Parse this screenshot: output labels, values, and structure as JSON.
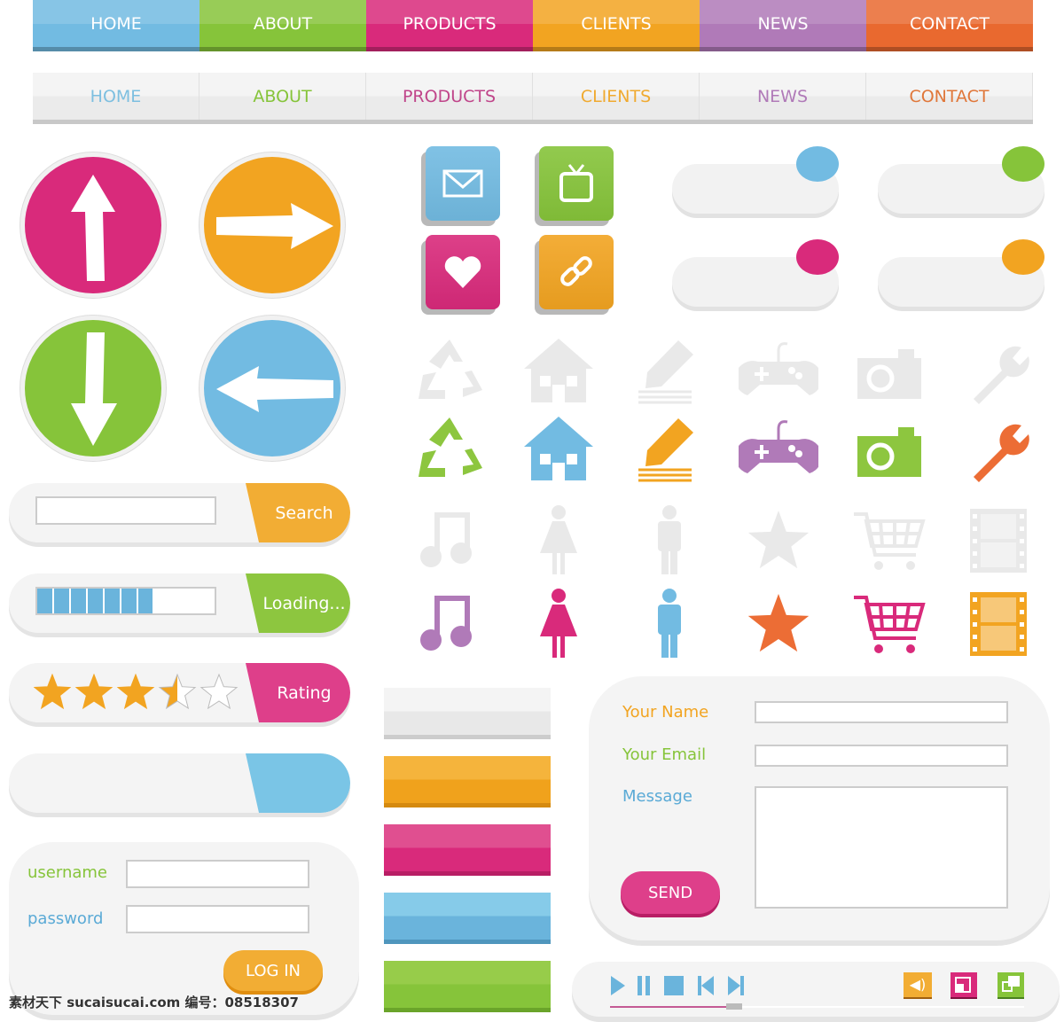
{
  "colors": {
    "blue": "#7ac5e6",
    "green": "#8dc63f",
    "pink": "#d8287a",
    "orange": "#f3a524",
    "purple": "#b57fc0",
    "red_orange": "#ec6d35",
    "gray": "#e6e6e6"
  },
  "nav_colored": [
    {
      "label": "HOME",
      "color": "#72bbe2"
    },
    {
      "label": "ABOUT",
      "color": "#86c43a"
    },
    {
      "label": "PRODUCTS",
      "color": "#d92a7b"
    },
    {
      "label": "CLIENTS",
      "color": "#f2a421"
    },
    {
      "label": "NEWS",
      "color": "#b07ab8"
    },
    {
      "label": "CONTACT",
      "color": "#e9692f"
    }
  ],
  "nav_light": [
    {
      "label": "HOME",
      "color": "#7dbfe0"
    },
    {
      "label": "ABOUT",
      "color": "#86c43a"
    },
    {
      "label": "PRODUCTS",
      "color": "#c0458a"
    },
    {
      "label": "CLIENTS",
      "color": "#f0aa30"
    },
    {
      "label": "NEWS",
      "color": "#b07ab8"
    },
    {
      "label": "CONTACT",
      "color": "#e0773a"
    }
  ],
  "round_buttons": [
    {
      "icon": "arrow-up-icon",
      "color": "#d92a7b"
    },
    {
      "icon": "arrow-right-icon",
      "color": "#f2a421"
    },
    {
      "icon": "arrow-down-icon",
      "color": "#86c43a"
    },
    {
      "icon": "arrow-left-icon",
      "color": "#72bbe2"
    }
  ],
  "cube_icons": [
    {
      "icon": "mail-icon",
      "color": "#72bbe2"
    },
    {
      "icon": "tv-icon",
      "color": "#86c43a"
    },
    {
      "icon": "heart-icon",
      "color": "#d92a7b"
    },
    {
      "icon": "link-icon",
      "color": "#f2a421"
    }
  ],
  "toggles": [
    {
      "color": "#72bbe2"
    },
    {
      "color": "#86c43a"
    },
    {
      "color": "#d92a7b"
    },
    {
      "color": "#f2a421"
    }
  ],
  "icon_grid": [
    [
      "recycle-icon",
      "house-icon",
      "pencil-icon",
      "gamepad-icon",
      "camera-icon",
      "wrench-icon"
    ],
    [
      "music-note-icon",
      "woman-icon",
      "man-icon",
      "star-icon",
      "cart-icon",
      "film-icon"
    ]
  ],
  "icon_colors": [
    [
      "#8dc63f",
      "#72bbe2",
      "#f2a421",
      "#b07ab8",
      "#8dc63f",
      "#ec6d35"
    ],
    [
      "#b07ab8",
      "#d92a7b",
      "#72bbe2",
      "#ec6d35",
      "#d92a7b",
      "#f2a421"
    ]
  ],
  "search": {
    "button": "Search",
    "value": ""
  },
  "loading": {
    "label": "Loading...",
    "progress": 0.65
  },
  "rating": {
    "label": "Rating",
    "value": 3.5,
    "max": 5
  },
  "login": {
    "username_label": "username",
    "password_label": "password",
    "button": "LOG IN"
  },
  "contact": {
    "name_label": "Your Name",
    "email_label": "Your Email",
    "message_label": "Message",
    "button": "SEND"
  },
  "player": {
    "progress": 0.28
  },
  "watermark": "素材天下 sucaisucai.com  编号：08518307"
}
